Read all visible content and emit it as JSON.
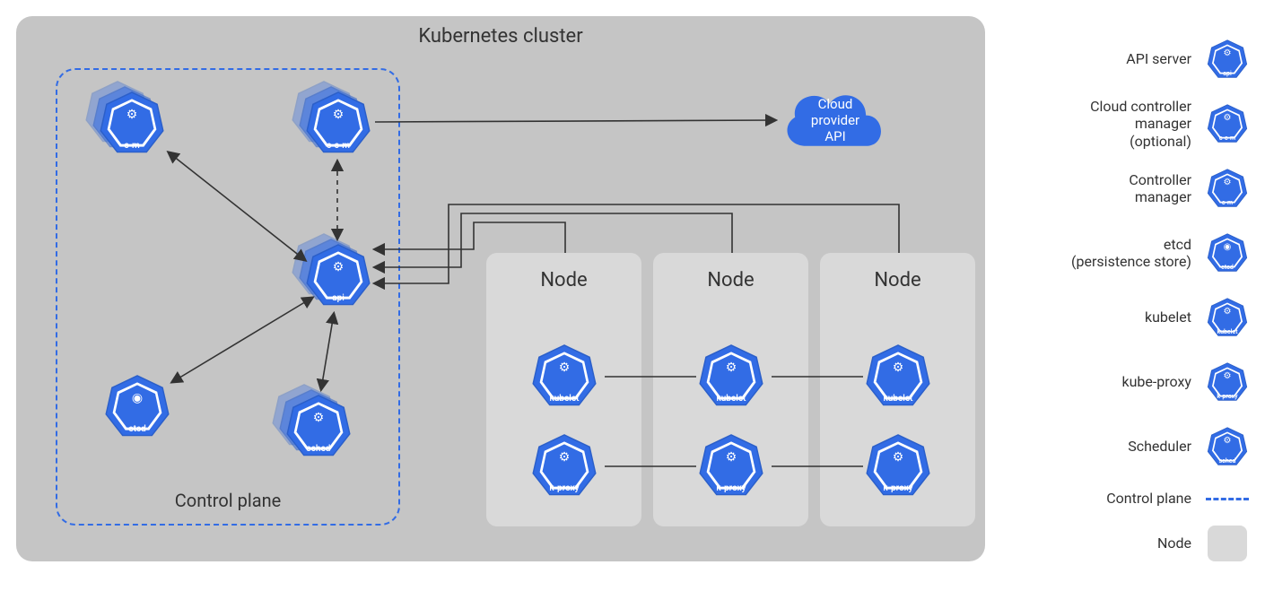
{
  "title": "Kubernetes cluster",
  "control_plane": {
    "label": "Control plane",
    "components": {
      "cm": {
        "label": "c-m",
        "icon": "gears"
      },
      "ccm": {
        "label": "c-c-m",
        "icon": "gears"
      },
      "api": {
        "label": "api",
        "icon": "gears"
      },
      "etcd": {
        "label": "etcd",
        "icon": "db"
      },
      "sched": {
        "label": "sched",
        "icon": "gears"
      }
    }
  },
  "cloud": {
    "line1": "Cloud",
    "line2": "provider",
    "line3": "API"
  },
  "nodes": [
    {
      "title": "Node",
      "kubelet": "kubelet",
      "kproxy": "k-proxy"
    },
    {
      "title": "Node",
      "kubelet": "kubelet",
      "kproxy": "k-proxy"
    },
    {
      "title": "Node",
      "kubelet": "kubelet",
      "kproxy": "k-proxy"
    }
  ],
  "legend": {
    "items": [
      {
        "text": "API server",
        "icon": "api"
      },
      {
        "text": "Cloud controller\nmanager\n(optional)",
        "icon": "c-c-m"
      },
      {
        "text": "Controller\nmanager",
        "icon": "c-m"
      },
      {
        "text": "etcd\n(persistence store)",
        "icon": "etcd"
      },
      {
        "text": "kubelet",
        "icon": "kubelet"
      },
      {
        "text": "kube-proxy",
        "icon": "k-proxy"
      },
      {
        "text": "Scheduler",
        "icon": "sched"
      }
    ],
    "control_plane_label": "Control plane",
    "node_label": "Node"
  },
  "colors": {
    "k8s_blue": "#326ce5",
    "k8s_blue_dark": "#2b5fc9"
  },
  "connections": [
    {
      "from": "api",
      "to": "cm",
      "style": "solid",
      "arrows": "both"
    },
    {
      "from": "api",
      "to": "ccm",
      "style": "dashed",
      "arrows": "both"
    },
    {
      "from": "api",
      "to": "etcd",
      "style": "solid",
      "arrows": "both"
    },
    {
      "from": "api",
      "to": "sched",
      "style": "solid",
      "arrows": "both"
    },
    {
      "from": "ccm",
      "to": "cloud",
      "style": "solid",
      "arrows": "end"
    },
    {
      "from": "node1",
      "to": "api",
      "style": "solid",
      "arrows": "end"
    },
    {
      "from": "node2",
      "to": "api",
      "style": "solid",
      "arrows": "end"
    },
    {
      "from": "node3",
      "to": "api",
      "style": "solid",
      "arrows": "end"
    }
  ]
}
